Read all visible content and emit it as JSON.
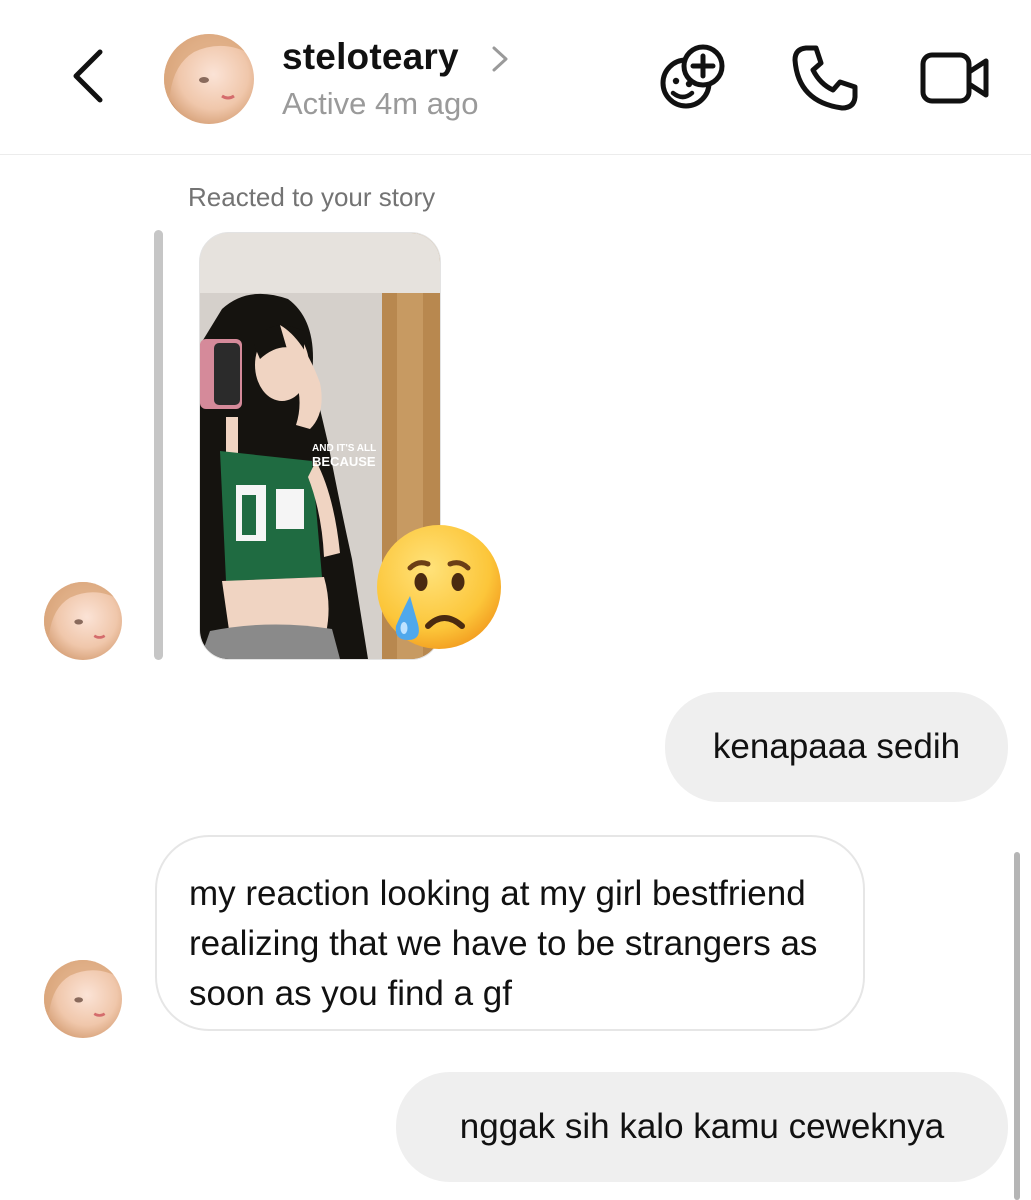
{
  "header": {
    "username": "steloteary",
    "status": "Active 4m ago",
    "icons": [
      "back-arrow-icon",
      "chevron-right-icon",
      "add-effects-icon",
      "phone-icon",
      "video-camera-icon"
    ]
  },
  "thread": {
    "story_label": "Reacted to your story",
    "story_overlay_line1": "AND IT'S ALL",
    "story_overlay_line2": "BECAUSE",
    "reaction_emoji": "crying-face",
    "messages": [
      {
        "from": "me",
        "text": "kenapaaa sedih"
      },
      {
        "from": "them",
        "text": "my reaction looking at my girl bestfriend realizing that we have to be strangers as soon as you find a gf"
      },
      {
        "from": "me",
        "text": "nggak sih kalo kamu ceweknya"
      }
    ]
  },
  "colors": {
    "outgoing_bubble": "#efefef",
    "incoming_border": "#e6e6e6",
    "secondary_text": "#737373"
  }
}
